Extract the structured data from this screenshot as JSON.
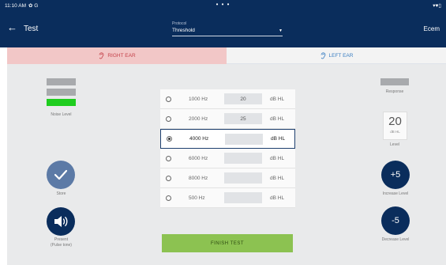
{
  "status": {
    "time": "11:10 AM",
    "left_icons": "✿ G",
    "center": "• • •",
    "right_icons": "▾♥▯"
  },
  "header": {
    "title": "Test",
    "protocol_label": "Protocol",
    "protocol_value": "Threshold",
    "user": "Ecem"
  },
  "tabs": [
    {
      "label": "RIGHT EAR",
      "active": true,
      "color": "#c4424a"
    },
    {
      "label": "LEFT EAR",
      "active": false,
      "color": "#3a7ec2"
    }
  ],
  "left_panel": {
    "noise_label": "Noise Level",
    "noise_level_active": 1,
    "store_label": "Store",
    "present_label_line1": "Present",
    "present_label_line2": "(Pulse tone)"
  },
  "frequencies": [
    {
      "label": "1000 Hz",
      "value": "20",
      "unit": "dB HL",
      "selected": false
    },
    {
      "label": "2000 Hz",
      "value": "25",
      "unit": "dB HL",
      "selected": false
    },
    {
      "label": "4000 Hz",
      "value": "",
      "unit": "dB HL",
      "selected": true
    },
    {
      "label": "6000 Hz",
      "value": "",
      "unit": "dB HL",
      "selected": false
    },
    {
      "label": "8000 Hz",
      "value": "",
      "unit": "dB HL",
      "selected": false
    },
    {
      "label": "500 Hz",
      "value": "",
      "unit": "dB HL",
      "selected": false
    }
  ],
  "right_panel": {
    "response_label": "Response",
    "level_value": "20",
    "level_unit": "dB HL",
    "level_label": "Level",
    "increase_text": "+5",
    "increase_label": "Increase Level",
    "decrease_text": "-5",
    "decrease_label": "Decrease Level"
  },
  "finish_label": "FINISH TEST",
  "colors": {
    "primary": "#0a2d5c",
    "right_ear": "#c4424a",
    "left_ear": "#3a7ec2",
    "finish": "#8cc251",
    "noise_active": "#1fcd1f"
  }
}
